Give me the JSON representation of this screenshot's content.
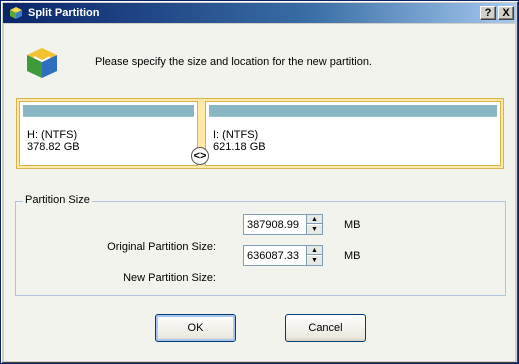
{
  "window": {
    "title": "Split Partition",
    "help_label": "?",
    "close_label": "X"
  },
  "intro_text": "Please specify the size and location for the new partition.",
  "partitions": {
    "left": {
      "name": "H: (NTFS)",
      "size": "378.82 GB"
    },
    "right": {
      "name": "I: (NTFS)",
      "size": "621.18 GB"
    },
    "splitter_glyph": "<>"
  },
  "partition_size": {
    "legend": "Partition Size",
    "original_label": "Original Partition Size:",
    "original_value": "387908.99",
    "new_label": "New Partition Size:",
    "new_value": "636087.33",
    "unit": "MB"
  },
  "buttons": {
    "ok_label": "OK",
    "cancel_label": "Cancel"
  },
  "icons": {
    "title": "app-cube-icon",
    "logo": "partition-tool-icon",
    "spin_up": "▲",
    "spin_down": "▼"
  }
}
